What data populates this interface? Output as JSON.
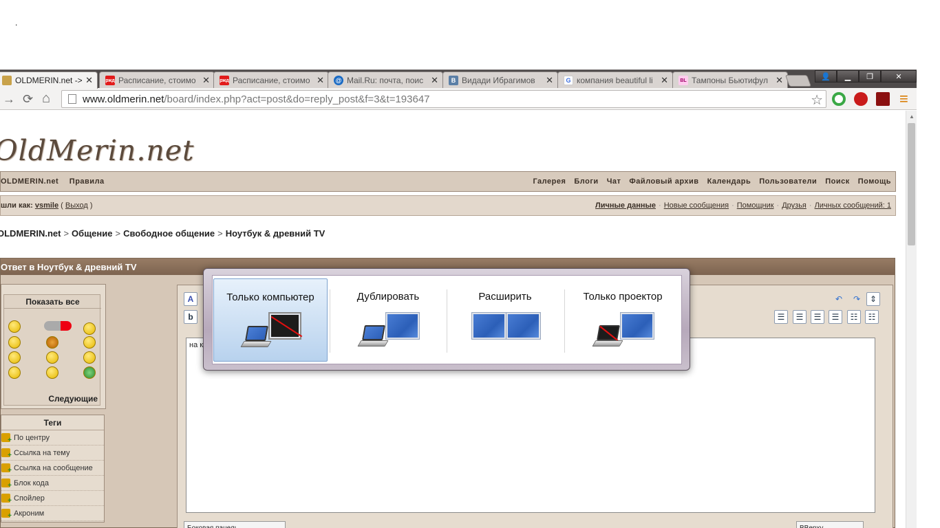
{
  "top_dot": ".",
  "tabs": [
    {
      "label": "OLDMERIN.net -> От",
      "icon": "oldmerin-favicon",
      "active": true
    },
    {
      "label": "Расписание, стоимо",
      "icon": "rzd-favicon"
    },
    {
      "label": "Расписание, стоимо",
      "icon": "rzd-favicon"
    },
    {
      "label": "Mail.Ru: почта, поис",
      "icon": "mailru-favicon"
    },
    {
      "label": "Видади Ибрагимов",
      "icon": "vk-favicon"
    },
    {
      "label": "компания beautiful li",
      "icon": "google-favicon"
    },
    {
      "label": "Тампоны Бьютифул",
      "icon": "bl-favicon"
    }
  ],
  "tab_close": "✕",
  "favicon_text": {
    "rzd": "ржд",
    "vk": "B",
    "google": "G",
    "bl": "BL",
    "mailru": "@"
  },
  "window_buttons": {
    "user": "👤",
    "minimize": "▁",
    "maximize": "❐",
    "close": "✕"
  },
  "toolbar": {
    "url_host": "www.oldmerin.net",
    "url_path": "/board/index.php?act=post&do=reply_post&f=3&t=193647",
    "back": "←",
    "forward": "→",
    "reload": "⟳",
    "home": "⌂",
    "star": "☆",
    "menu": "≡"
  },
  "site": {
    "logo": "OldMerin.net",
    "nav_left": [
      "OLDMERIN.net",
      "Правила"
    ],
    "nav_right": [
      "Галерея",
      "Блоги",
      "Чат",
      "Файловый архив",
      "Календарь",
      "Пользователи",
      "Поиск",
      "Помощь"
    ],
    "login_prefix": "шли как:",
    "login_user": "vsmile",
    "login_logout": "Выход",
    "user_links": [
      "Личные данные",
      "Новые сообщения",
      "Помощник",
      "Друзья",
      "Личных сообщений: 1"
    ],
    "breadcrumb": [
      "OLDMERIN.net",
      "Общение",
      "Свободное общение",
      "Ноутбук & древний TV"
    ],
    "breadcrumb_sep": ">",
    "reply_title": "Ответ в Ноутбук & древний TV",
    "smilies_title": "Показать все",
    "smilies_more": "Следующие",
    "tags_title": "Теги",
    "tags": [
      "По центру",
      "Ссылка на тему",
      "Ссылка на сообщение",
      "Блок кода",
      "Спойлер",
      "Акроним"
    ],
    "textarea_value": "на к",
    "bold_button": "b",
    "bottom_left_button": "Боковая панель",
    "bottom_right_button": "ВВерху"
  },
  "projector_dialog": {
    "options": [
      {
        "label": "Только компьютер",
        "selected": true
      },
      {
        "label": "Дублировать"
      },
      {
        "label": "Расширить"
      },
      {
        "label": "Только проектор"
      }
    ]
  },
  "colors": {
    "tabstrip": "#4e4a4a",
    "forum_header": "#d8cbbd",
    "reply_header": "#7d6450",
    "selection": "#b8d2ee",
    "monitor_blue": "#2c5fb8",
    "disabled_line": "#e01010"
  }
}
